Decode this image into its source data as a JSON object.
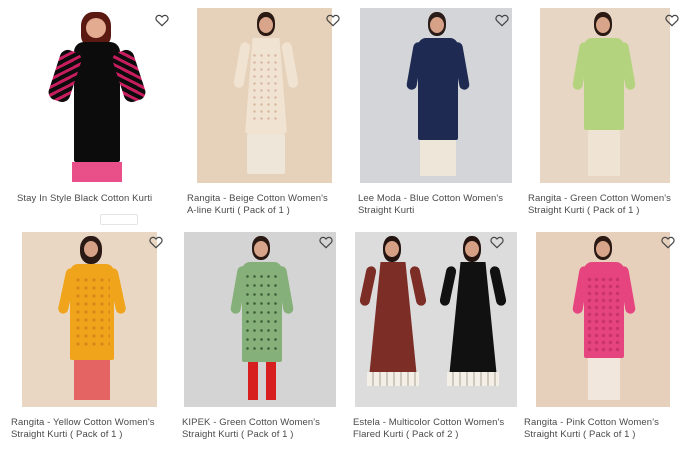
{
  "products": [
    {
      "title": "Stay In Style Black Cotton Kurti",
      "bg": "#ffffff",
      "kurti": "#0c0c0c",
      "bottom": "#e9508a",
      "accent": "#c51d5d",
      "wishlist_icon": "heart-outline-icon"
    },
    {
      "title": "Rangita - Beige Cotton Women's A-line Kurti ( Pack of 1 )",
      "bg": "#e6d2ba",
      "kurti": "#f1e3d2",
      "bottom": "#efe6da",
      "accent": "#d8b9a2",
      "wishlist_icon": "heart-outline-icon"
    },
    {
      "title": "Lee Moda - Blue Cotton Women's Straight Kurti",
      "bg": "#d3d5d8",
      "kurti": "#1e2a52",
      "bottom": "#eee7d9",
      "accent": "#2c3a66",
      "wishlist_icon": "heart-outline-icon"
    },
    {
      "title": "Rangita - Green Cotton Women's Straight Kurti ( Pack of 1 )",
      "bg": "#e7d6c4",
      "kurti": "#b4d37f",
      "bottom": "#efe4d3",
      "accent": "#9cbd67",
      "wishlist_icon": "heart-outline-icon"
    },
    {
      "title": "Rangita - Yellow Cotton Women's Straight Kurti ( Pack of 1 )",
      "bg": "#e9d7c4",
      "kurti": "#f0a41c",
      "bottom": "#e46363",
      "accent": "#d9891a",
      "wishlist_icon": "heart-outline-icon"
    },
    {
      "title": "KIPEK - Green Cotton Women's Straight Kurti ( Pack of 1 )",
      "bg": "#d4d4d4",
      "kurti": "#86b07a",
      "bottom": "#d81f1f",
      "accent": "#5e8c55",
      "wishlist_icon": "heart-outline-icon"
    },
    {
      "title": "Estela - Multicolor Cotton Women's Flared Kurti ( Pack of 2 )",
      "bg": "#dcdcdc",
      "kurti": "#7c2d25",
      "bottom": "#f3efe7",
      "accent": "#111111",
      "wishlist_icon": "heart-outline-icon"
    },
    {
      "title": "Rangita - Pink Cotton Women's Straight Kurti ( Pack of 1 )",
      "bg": "#e6cfbb",
      "kurti": "#e5447f",
      "bottom": "#f2e7dc",
      "accent": "#c8336a",
      "wishlist_icon": "heart-outline-icon"
    }
  ]
}
